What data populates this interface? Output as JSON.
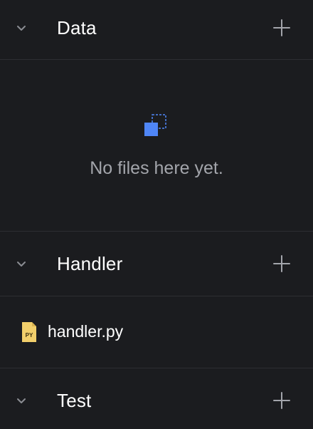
{
  "sections": {
    "data": {
      "title": "Data",
      "empty_message": "No files here yet."
    },
    "handler": {
      "title": "Handler",
      "files": [
        {
          "name": "handler.py",
          "icon": "python-file-icon",
          "badge": "PY"
        }
      ]
    },
    "test": {
      "title": "Test"
    }
  },
  "colors": {
    "background": "#1b1c1f",
    "divider": "#2d2e32",
    "accent": "#4f86f7",
    "muted_text": "#a3a5ab",
    "file_icon": "#f2cf6b"
  }
}
